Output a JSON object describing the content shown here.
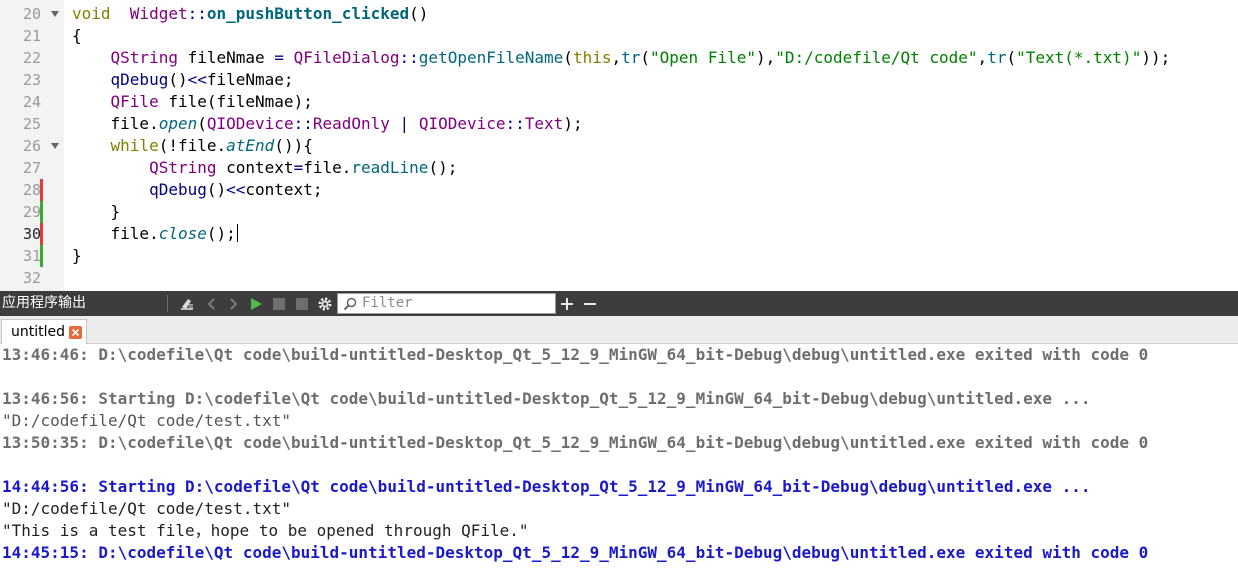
{
  "editor": {
    "lines": [
      {
        "num": "20",
        "fold": true,
        "mark": "",
        "current": false,
        "tokens": [
          [
            "kw",
            "void"
          ],
          [
            "",
            "  "
          ],
          [
            "ty",
            "Widget"
          ],
          [
            "op",
            "::"
          ],
          [
            "fnb",
            "on_pushButton_clicked"
          ],
          [
            "",
            "()"
          ]
        ]
      },
      {
        "num": "21",
        "fold": false,
        "mark": "",
        "current": false,
        "tokens": [
          [
            "",
            "{"
          ]
        ]
      },
      {
        "num": "22",
        "fold": false,
        "mark": "",
        "current": false,
        "tokens": [
          [
            "",
            "    "
          ],
          [
            "ty",
            "QString"
          ],
          [
            "",
            " fileNmae "
          ],
          [
            "op",
            "="
          ],
          [
            "",
            ""
          ],
          [
            "ty",
            " QFileDialog"
          ],
          [
            "op",
            "::"
          ],
          [
            "fn",
            "getOpenFileName"
          ],
          [
            "",
            "("
          ],
          [
            "kw",
            "this"
          ],
          [
            "",
            ","
          ],
          [
            "fn",
            "tr"
          ],
          [
            "",
            "("
          ],
          [
            "str",
            "\"Open File\""
          ],
          [
            "",
            "),"
          ],
          [
            "str",
            "\"D:/codefile/Qt code\""
          ],
          [
            "",
            ","
          ],
          [
            "fn",
            "tr"
          ],
          [
            "",
            "("
          ],
          [
            "str",
            "\"Text(*.txt)\""
          ],
          [
            "",
            "));"
          ]
        ]
      },
      {
        "num": "23",
        "fold": false,
        "mark": "",
        "current": false,
        "tokens": [
          [
            "",
            "    "
          ],
          [
            "mac",
            "qDebug"
          ],
          [
            "",
            "()"
          ],
          [
            "op",
            "<<"
          ],
          [
            "",
            "fileNmae;"
          ]
        ]
      },
      {
        "num": "24",
        "fold": false,
        "mark": "",
        "current": false,
        "tokens": [
          [
            "",
            "    "
          ],
          [
            "ty",
            "QFile"
          ],
          [
            "",
            " file(fileNmae);"
          ]
        ]
      },
      {
        "num": "25",
        "fold": false,
        "mark": "",
        "current": false,
        "tokens": [
          [
            "",
            "    file."
          ],
          [
            "vf",
            "open"
          ],
          [
            "",
            "("
          ],
          [
            "ty",
            "QIODevice"
          ],
          [
            "op",
            "::"
          ],
          [
            "ty",
            "ReadOnly"
          ],
          [
            "op",
            " | "
          ],
          [
            "ty",
            "QIODevice"
          ],
          [
            "op",
            "::"
          ],
          [
            "ty",
            "Text"
          ],
          [
            "",
            ");"
          ]
        ]
      },
      {
        "num": "26",
        "fold": true,
        "mark": "",
        "current": false,
        "tokens": [
          [
            "",
            "    "
          ],
          [
            "kw",
            "while"
          ],
          [
            "",
            "(!file."
          ],
          [
            "vf",
            "atEnd"
          ],
          [
            "",
            "()){"
          ]
        ]
      },
      {
        "num": "27",
        "fold": false,
        "mark": "",
        "current": false,
        "tokens": [
          [
            "",
            "        "
          ],
          [
            "ty",
            "QString"
          ],
          [
            "",
            " context"
          ],
          [
            "op",
            "="
          ],
          [
            "",
            "file."
          ],
          [
            "fn",
            "readLine"
          ],
          [
            "",
            "();"
          ]
        ]
      },
      {
        "num": "28",
        "fold": false,
        "mark": "red",
        "current": false,
        "tokens": [
          [
            "",
            "        "
          ],
          [
            "mac",
            "qDebug"
          ],
          [
            "",
            "()"
          ],
          [
            "op",
            "<<"
          ],
          [
            "",
            "context;"
          ]
        ]
      },
      {
        "num": "29",
        "fold": false,
        "mark": "green",
        "current": false,
        "tokens": [
          [
            "",
            "    }"
          ]
        ]
      },
      {
        "num": "30",
        "fold": false,
        "mark": "red",
        "current": true,
        "tokens": [
          [
            "",
            "    file."
          ],
          [
            "vf",
            "close"
          ],
          [
            "",
            "();"
          ]
        ]
      },
      {
        "num": "31",
        "fold": false,
        "mark": "green",
        "current": false,
        "tokens": [
          [
            "",
            "}"
          ]
        ]
      },
      {
        "num": "32",
        "fold": false,
        "mark": "",
        "current": false,
        "tokens": []
      }
    ]
  },
  "pane": {
    "title": "应用程序输出",
    "filter_placeholder": "Filter",
    "icons": [
      "clear-icon",
      "prev-icon",
      "next-icon",
      "run-icon",
      "stop-icon",
      "settings-icon",
      "add-icon",
      "minus-icon"
    ]
  },
  "tabs": [
    {
      "label": "untitled"
    }
  ],
  "output": [
    {
      "style": "o-gray",
      "text": "13:46:46: D:\\codefile\\Qt code\\build-untitled-Desktop_Qt_5_12_9_MinGW_64_bit-Debug\\debug\\untitled.exe exited with code 0"
    },
    {
      "style": "",
      "text": ""
    },
    {
      "style": "o-gray",
      "text": "13:46:56: Starting D:\\codefile\\Qt code\\build-untitled-Desktop_Qt_5_12_9_MinGW_64_bit-Debug\\debug\\untitled.exe ..."
    },
    {
      "style": "o-plain",
      "text": "\"D:/codefile/Qt code/test.txt\""
    },
    {
      "style": "o-gray",
      "text": "13:50:35: D:\\codefile\\Qt code\\build-untitled-Desktop_Qt_5_12_9_MinGW_64_bit-Debug\\debug\\untitled.exe exited with code 0"
    },
    {
      "style": "",
      "text": ""
    },
    {
      "style": "o-blue",
      "text": "14:44:56: Starting D:\\codefile\\Qt code\\build-untitled-Desktop_Qt_5_12_9_MinGW_64_bit-Debug\\debug\\untitled.exe ..."
    },
    {
      "style": "o-black",
      "text": "\"D:/codefile/Qt code/test.txt\""
    },
    {
      "style": "o-black",
      "text": "\"This is a test file，hope to be opened through QFile.\""
    },
    {
      "style": "o-blue",
      "text": "14:45:15: D:\\codefile\\Qt code\\build-untitled-Desktop_Qt_5_12_9_MinGW_64_bit-Debug\\debug\\untitled.exe exited with code 0"
    }
  ]
}
